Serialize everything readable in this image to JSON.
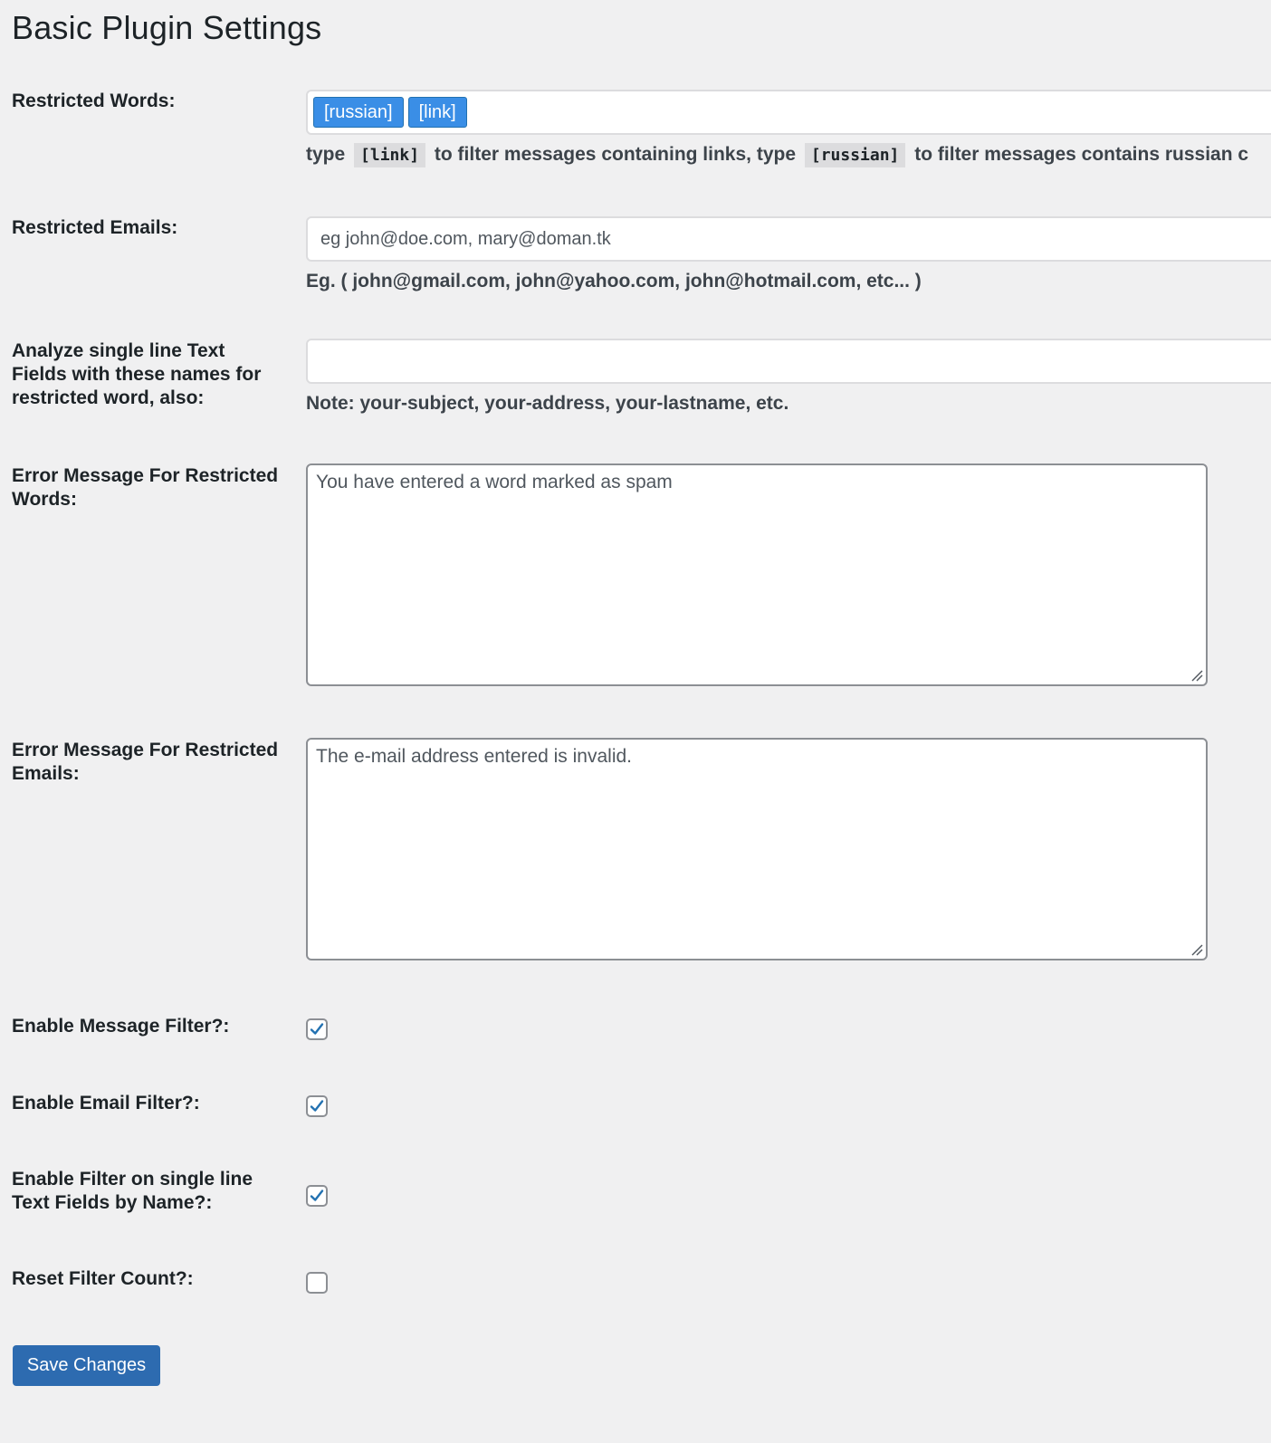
{
  "page": {
    "title": "Basic Plugin Settings"
  },
  "restricted_words": {
    "label": "Restricted Words:",
    "tags": [
      "[russian]",
      "[link]"
    ],
    "help_prefix": "type",
    "help_code_link": "[link]",
    "help_middle": "to filter messages containing links, type",
    "help_code_russian": "[russian]",
    "help_suffix": "to filter messages contains russian c"
  },
  "restricted_emails": {
    "label": "Restricted Emails:",
    "placeholder": "eg john@doe.com, mary@doman.tk",
    "help": "Eg. ( john@gmail.com, john@yahoo.com, john@hotmail.com, etc... )"
  },
  "text_fields": {
    "label": "Analyze single line Text Fields with these names for restricted word, also:",
    "value": "",
    "help": "Note: your-subject, your-address, your-lastname, etc."
  },
  "error_words": {
    "label": "Error Message For Restricted Words:",
    "value": "You have entered a word marked as spam"
  },
  "error_emails": {
    "label": "Error Message For Restricted Emails:",
    "value": "The e-mail address entered is invalid."
  },
  "checkboxes": {
    "message_filter": {
      "label": "Enable Message Filter?:",
      "checked": true
    },
    "email_filter": {
      "label": "Enable Email Filter?:",
      "checked": true
    },
    "name_filter": {
      "label": "Enable Filter on single line Text Fields by Name?:",
      "checked": true
    },
    "reset_count": {
      "label": "Reset Filter Count?:",
      "checked": false
    }
  },
  "save": {
    "label": "Save Changes"
  },
  "colors": {
    "accent": "#2271b1",
    "tag": "#3a8ee6",
    "button": "#2d6bb0",
    "background": "#f0f0f1"
  }
}
